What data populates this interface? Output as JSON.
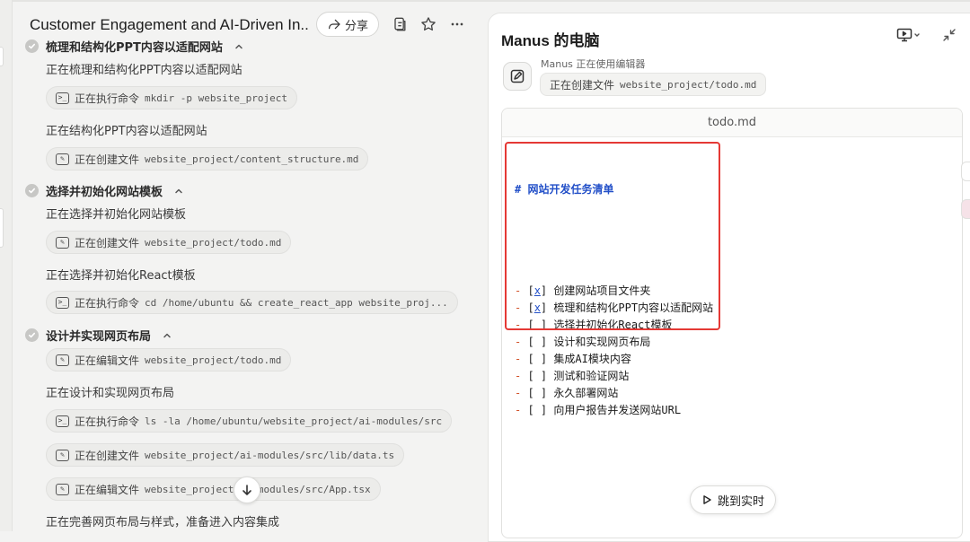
{
  "header": {
    "title": "Customer Engagement and AI-Driven In...",
    "share_label": "分享"
  },
  "icons": {
    "share": "share-icon",
    "copy": "copy-icon",
    "star": "star-icon",
    "more": "more-icon",
    "terminal": "terminal-icon",
    "edit": "edit-icon",
    "monitor": "monitor-icon",
    "collapse": "collapse-icon",
    "scroll_down": "arrow-down-icon",
    "play": "play-icon"
  },
  "steps": [
    {
      "title": "梳理和结构化PPT内容以适配网站",
      "items": [
        {
          "type": "text",
          "text": "正在梳理和结构化PPT内容以适配网站"
        },
        {
          "type": "terminal",
          "label": "正在执行命令",
          "detail": "mkdir -p website_project"
        },
        {
          "type": "text",
          "text": "正在结构化PPT内容以适配网站"
        },
        {
          "type": "edit",
          "label": "正在创建文件",
          "detail": "website_project/content_structure.md"
        }
      ]
    },
    {
      "title": "选择并初始化网站模板",
      "items": [
        {
          "type": "text",
          "text": "正在选择并初始化网站模板"
        },
        {
          "type": "edit",
          "label": "正在创建文件",
          "detail": "website_project/todo.md"
        },
        {
          "type": "text",
          "text": "正在选择并初始化React模板"
        },
        {
          "type": "terminal",
          "label": "正在执行命令",
          "detail": "cd /home/ubuntu && create_react_app website_proj..."
        }
      ]
    },
    {
      "title": "设计并实现网页布局",
      "items": [
        {
          "type": "edit",
          "label": "正在编辑文件",
          "detail": "website_project/todo.md"
        },
        {
          "type": "text",
          "text": "正在设计和实现网页布局"
        },
        {
          "type": "terminal",
          "label": "正在执行命令",
          "detail": "ls -la /home/ubuntu/website_project/ai-modules/src"
        },
        {
          "type": "edit",
          "label": "正在创建文件",
          "detail": "website_project/ai-modules/src/lib/data.ts"
        },
        {
          "type": "edit",
          "label": "正在编辑文件",
          "detail": "website_project/ai-modules/src/App.tsx"
        },
        {
          "type": "text",
          "text": "正在完善网页布局与样式，准备进入内容集成"
        }
      ]
    }
  ],
  "computer": {
    "title": "Manus 的电脑",
    "using_text": "Manus 正在使用编辑器",
    "file_action": "正在创建文件",
    "file_path": "website_project/todo.md",
    "editor_filename": "todo.md",
    "heading": "# 网站开发任务清单",
    "tasks": [
      {
        "checked": true,
        "text": "创建网站项目文件夹"
      },
      {
        "checked": true,
        "text": "梳理和结构化PPT内容以适配网站"
      },
      {
        "checked": false,
        "text": "选择并初始化React模板"
      },
      {
        "checked": false,
        "text": "设计和实现网页布局"
      },
      {
        "checked": false,
        "text": "集成AI模块内容"
      },
      {
        "checked": false,
        "text": "测试和验证网站"
      },
      {
        "checked": false,
        "text": "永久部署网站"
      },
      {
        "checked": false,
        "text": "向用户报告并发送网站URL"
      }
    ],
    "jump_label": "跳到实时"
  },
  "colors": {
    "highlight_border": "#e53935",
    "heading_blue": "#2350c8",
    "list_dash": "#d2532b"
  }
}
